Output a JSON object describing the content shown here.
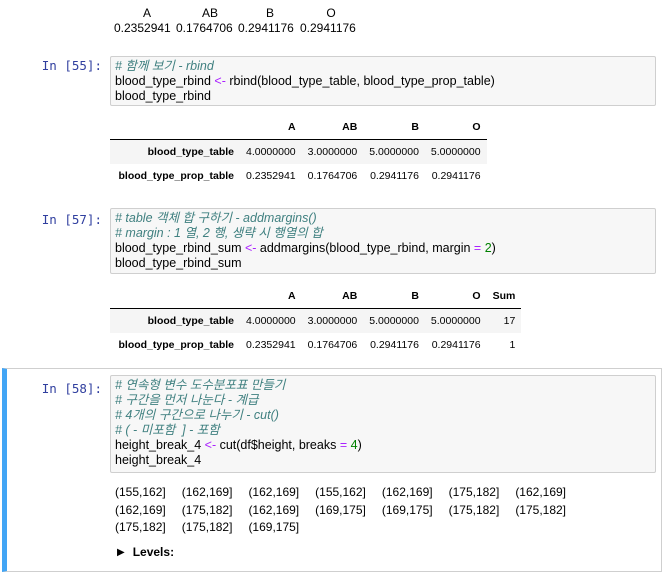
{
  "top_output": {
    "headers": [
      "A",
      "AB",
      "B",
      "O"
    ],
    "values": [
      "0.2352941",
      "0.1764706",
      "0.2941176",
      "0.2941176"
    ]
  },
  "cell55": {
    "prompt": "In [55]:",
    "lines": {
      "l1": "# 함께 보기 - rbind",
      "l2a": "blood_type_rbind ",
      "l2op": "<-",
      "l2b": " rbind(blood_type_table, blood_type_prop_table)",
      "l3": "blood_type_rbind"
    },
    "table": {
      "columns": [
        "A",
        "AB",
        "B",
        "O"
      ],
      "rows": [
        {
          "label": "blood_type_table",
          "cells": [
            "4.0000000",
            "3.0000000",
            "5.0000000",
            "5.0000000"
          ]
        },
        {
          "label": "blood_type_prop_table",
          "cells": [
            "0.2352941",
            "0.1764706",
            "0.2941176",
            "0.2941176"
          ]
        }
      ]
    }
  },
  "cell57": {
    "prompt": "In [57]:",
    "lines": {
      "l1": "# table 객체 합 구하기 - addmargins()",
      "l2": "# margin : 1 열, 2 행, 생략 시 행열의 합",
      "l3a": "blood_type_rbind_sum ",
      "l3op": "<-",
      "l3b": " addmargins(blood_type_rbind, margin ",
      "l3eq": "=",
      "l3sp": " ",
      "l3num": "2",
      "l3c": ")",
      "l4": "blood_type_rbind_sum"
    },
    "table": {
      "columns": [
        "A",
        "AB",
        "B",
        "O",
        "Sum"
      ],
      "rows": [
        {
          "label": "blood_type_table",
          "cells": [
            "4.0000000",
            "3.0000000",
            "5.0000000",
            "5.0000000",
            "17"
          ]
        },
        {
          "label": "blood_type_prop_table",
          "cells": [
            "0.2352941",
            "0.1764706",
            "0.2941176",
            "0.2941176",
            "1"
          ]
        }
      ]
    }
  },
  "cell58": {
    "prompt": "In [58]:",
    "lines": {
      "l1": "# 연속형 변수 도수분포표 만들기",
      "l2": "# 구간을 먼저 나눈다 - 계급",
      "l3": "# 4개의 구간으로 나누기 - cut()",
      "l4": "# ( - 미포함  ] - 포함",
      "l5a": "height_break_4 ",
      "l5op": "<-",
      "l5b": " cut(df$height, breaks ",
      "l5eq": "=",
      "l5sp": " ",
      "l5num": "4",
      "l5c": ")",
      "l6": "height_break_4"
    },
    "factor_values": [
      "(155,162]",
      "(162,169]",
      "(162,169]",
      "(155,162]",
      "(162,169]",
      "(175,182]",
      "(162,169]",
      "(162,169]",
      "(175,182]",
      "(162,169]",
      "(169,175]",
      "(169,175]",
      "(175,182]",
      "(175,182]",
      "(175,182]",
      "(175,182]",
      "(169,175]"
    ],
    "levels_label": "Levels:"
  }
}
